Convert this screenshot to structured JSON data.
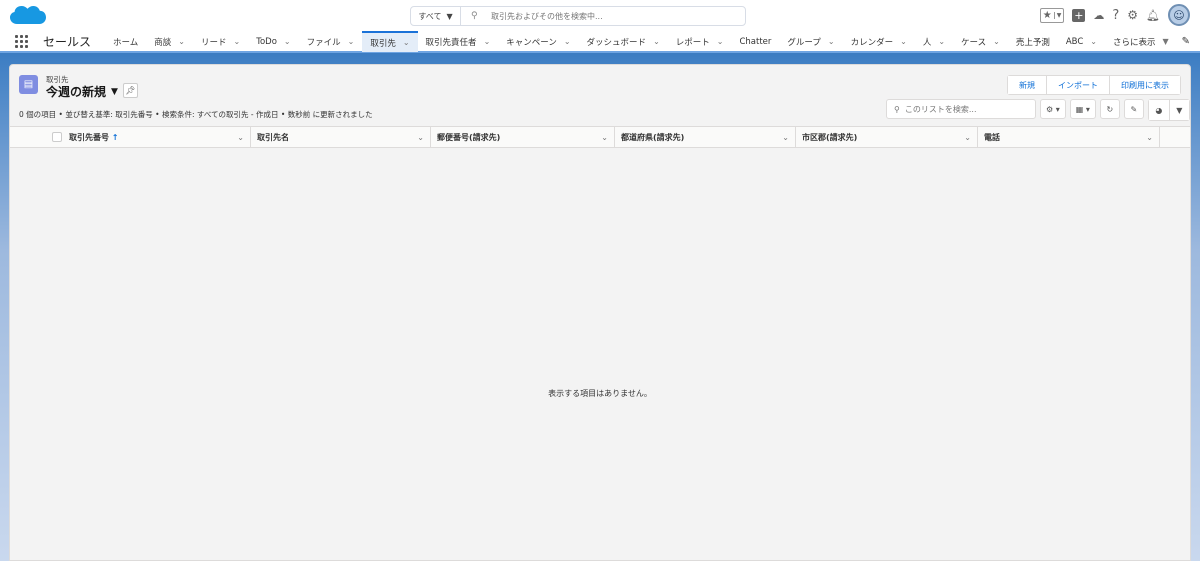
{
  "header": {
    "search_scope": "すべて",
    "search_placeholder": "取引先およびその他を検索中..."
  },
  "nav": {
    "app_name": "セールス",
    "items": [
      {
        "label": "ホーム",
        "chevron": false
      },
      {
        "label": "商談",
        "chevron": true
      },
      {
        "label": "リード",
        "chevron": true
      },
      {
        "label": "ToDo",
        "chevron": true
      },
      {
        "label": "ファイル",
        "chevron": true
      },
      {
        "label": "取引先",
        "chevron": true,
        "active": true
      },
      {
        "label": "取引先責任者",
        "chevron": true
      },
      {
        "label": "キャンペーン",
        "chevron": true
      },
      {
        "label": "ダッシュボード",
        "chevron": true
      },
      {
        "label": "レポート",
        "chevron": true
      },
      {
        "label": "Chatter",
        "chevron": false
      },
      {
        "label": "グループ",
        "chevron": true
      },
      {
        "label": "カレンダー",
        "chevron": true
      },
      {
        "label": "人",
        "chevron": true
      },
      {
        "label": "ケース",
        "chevron": true
      },
      {
        "label": "売上予測",
        "chevron": false
      },
      {
        "label": "ABC",
        "chevron": true
      }
    ],
    "more": "さらに表示"
  },
  "list": {
    "object_label": "取引先",
    "view_title": "今週の新規",
    "meta": "0 個の項目 • 並び替え基準: 取引先番号 • 検索条件: すべての取引先 - 作成日 • 数秒前 に更新されました",
    "buttons": [
      "新規",
      "インポート",
      "印刷用に表示"
    ],
    "search_placeholder": "このリストを検索...",
    "columns": [
      {
        "label": "取引先番号",
        "sorted": "↑"
      },
      {
        "label": "取引先名"
      },
      {
        "label": "郵便番号(請求先)"
      },
      {
        "label": "都道府県(請求先)"
      },
      {
        "label": "市区郡(請求先)"
      },
      {
        "label": "電話"
      }
    ],
    "empty_message": "表示する項目はありません。"
  }
}
